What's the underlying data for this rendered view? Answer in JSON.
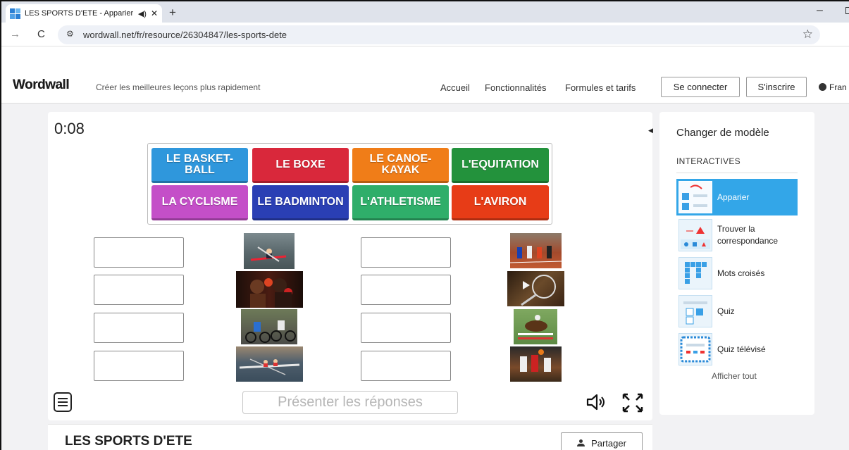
{
  "browser": {
    "tab_title": "LES SPORTS D'ETE - Apparier",
    "new_tab": "+",
    "tab_close": "✕",
    "back": "→",
    "reload": "C",
    "url": "wordwall.net/fr/resource/26304847/les-sports-dete",
    "minimize": "–",
    "star": "☆"
  },
  "header": {
    "logo": "Wordwall",
    "tagline": "Créer les meilleures leçons plus rapidement",
    "nav": [
      "Accueil",
      "Fonctionnalités",
      "Formules et tarifs"
    ],
    "login": "Se connecter",
    "signup": "S'inscrire",
    "language": "Fran"
  },
  "activity": {
    "timer": "0:08",
    "tiles": [
      {
        "label": "LE BASKET-BALL",
        "color": "#2f97dc"
      },
      {
        "label": "LE BOXE",
        "color": "#d9283b"
      },
      {
        "label": "LE CANOE-KAYAK",
        "color": "#f07d18"
      },
      {
        "label": "L'EQUITATION",
        "color": "#23923c"
      },
      {
        "label": "LA CYCLISME",
        "color": "#c44fc8"
      },
      {
        "label": "LE BADMINTON",
        "color": "#2a3fb4"
      },
      {
        "label": "L'ATHLETISME",
        "color": "#2fae6a"
      },
      {
        "label": "L'AVIRON",
        "color": "#e73c17"
      }
    ],
    "photos_left": [
      "canoe-kayak",
      "boxe",
      "cyclisme",
      "aviron"
    ],
    "photos_right": [
      "athletisme",
      "badminton",
      "equitation",
      "basket-ball"
    ],
    "reveal_button": "Présenter les réponses",
    "title": "LES SPORTS D'ETE",
    "share": "Partager"
  },
  "sidebar": {
    "title": "Changer de modèle",
    "section": "INTERACTIVES",
    "templates": [
      {
        "label": "Apparier",
        "active": true
      },
      {
        "label": "Trouver la correspondance",
        "active": false
      },
      {
        "label": "Mots croisés",
        "active": false
      },
      {
        "label": "Quiz",
        "active": false
      },
      {
        "label": "Quiz télévisé",
        "active": false
      }
    ],
    "show_all": "Afficher tout"
  }
}
